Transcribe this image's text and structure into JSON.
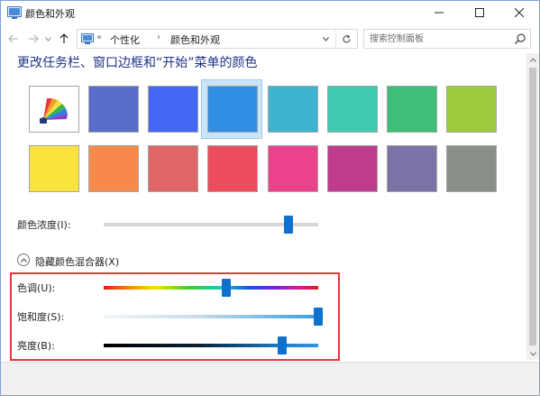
{
  "window": {
    "title": "颜色和外观",
    "minimize_glyph": "—",
    "maximize_glyph": "☐",
    "close_glyph": "✕"
  },
  "address_bar": {
    "overflow_chevron": "«",
    "breadcrumbs": [
      "个性化",
      "颜色和外观"
    ],
    "separator": "›"
  },
  "search": {
    "placeholder": "搜索控制面板"
  },
  "content": {
    "heading": "更改任务栏、窗口边框和“开始”菜单的颜色",
    "swatches": [
      {
        "color": "auto",
        "icon": "color-fan-icon",
        "selected": false
      },
      {
        "color": "#5a6dcb",
        "selected": false
      },
      {
        "color": "#4367f5",
        "selected": false
      },
      {
        "color": "#318ee4",
        "selected": true
      },
      {
        "color": "#3fb4d0",
        "selected": false
      },
      {
        "color": "#3ec9b0",
        "selected": false
      },
      {
        "color": "#3dbf78",
        "selected": false
      },
      {
        "color": "#9ccb3f",
        "selected": false
      },
      {
        "color": "#fbe33e",
        "selected": false
      },
      {
        "color": "#f7894a",
        "selected": false
      },
      {
        "color": "#e06666",
        "selected": false
      },
      {
        "color": "#ec4d5c",
        "selected": false
      },
      {
        "color": "#ea428b",
        "selected": false
      },
      {
        "color": "#bf3b8e",
        "selected": false
      },
      {
        "color": "#7d72a8",
        "selected": false
      },
      {
        "color": "#8a9088",
        "selected": false
      }
    ],
    "intensity": {
      "label": "颜色浓度(I):",
      "value_fraction": 0.86
    },
    "mixer_toggle": {
      "label": "隐藏颜色混合器(X)",
      "glyph": "︿"
    },
    "hue": {
      "label": "色调(U):",
      "value_fraction": 0.57
    },
    "saturation": {
      "label": "饱和度(S):",
      "value_fraction": 1.0
    },
    "brightness": {
      "label": "亮度(B):",
      "value_fraction": 0.83
    }
  },
  "colors": {
    "accent": "#0e72cc",
    "heading": "#1e3287",
    "highlight_border": "#e0383e",
    "selected_frame": "#cce4f7"
  }
}
